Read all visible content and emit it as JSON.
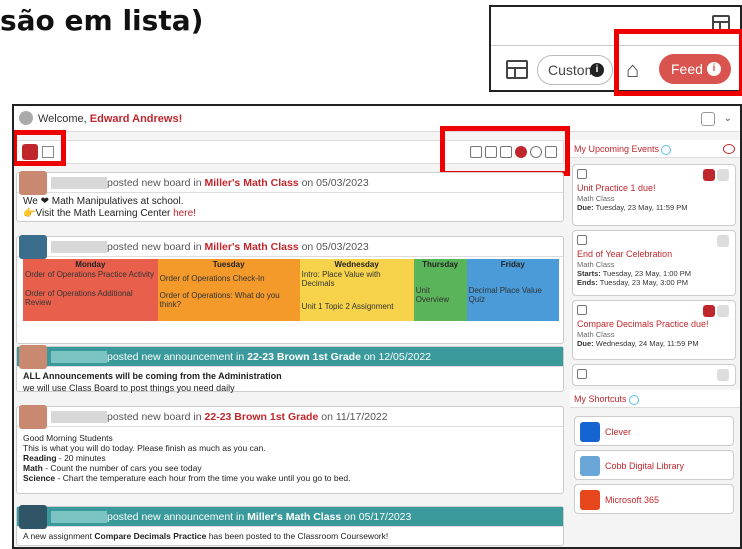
{
  "page_title": "são em lista)",
  "zoom_panel": {
    "custom_label": "Custom",
    "feed_label": "Feed",
    "info_glyph": "i"
  },
  "header": {
    "welcome_prefix": "Welcome,",
    "user_name": "Edward Andrews!"
  },
  "posts": [
    {
      "action": "posted new board",
      "in_word": "in",
      "class_name": "Miller's Math Class",
      "on_word": "on",
      "date": "05/03/2023",
      "line1": "We ❤ Math Manipulatives at school.",
      "line2_prefix": "👉Visit the Math Learning Center ",
      "line2_link": "here!"
    },
    {
      "action": "posted new board",
      "in_word": "in",
      "class_name": "Miller's Math Class",
      "on_word": "on",
      "date": "05/03/2023",
      "days": [
        "Monday",
        "Tuesday",
        "Wednesday",
        "Thursday",
        "Friday"
      ],
      "cells": [
        [
          "Order of Operations Practice Activity",
          "Order of Operations Additional Review"
        ],
        [
          "Order of Operations Check-In",
          "Order of Operations: What do you think?"
        ],
        [
          "Intro: Place Value with Decimals",
          "Unit 1 Topic 2 Assignment"
        ],
        [
          "Unit Overview"
        ],
        [
          "Decimal Place Value Quiz"
        ]
      ]
    },
    {
      "action": "posted new announcement",
      "in_word": "in",
      "class_name": "22-23 Brown 1st Grade",
      "on_word": "on",
      "date": "12/05/2022",
      "line1": "ALL Announcements will be coming from the Administration",
      "line2": "we will use Class Board to post things you need daily"
    },
    {
      "action": "posted new board",
      "in_word": "in",
      "class_name": "22-23 Brown 1st Grade",
      "on_word": "on",
      "date": "11/17/2022",
      "lines": [
        "Good Morning Students",
        "This is what you will do today.  Please finish as much as you can."
      ],
      "items": [
        {
          "label": "Reading",
          "text": " - 20 minutes"
        },
        {
          "label": "Math",
          "text": " - Count the number of cars you see today"
        },
        {
          "label": "Science",
          "text": " - Chart the temperature each hour from the time you wake until you go to bed."
        }
      ]
    },
    {
      "action": "posted new announcement",
      "in_word": "in",
      "class_name": "Miller's Math Class",
      "on_word": "on",
      "date": "05/17/2023",
      "text_prefix": "A new assignment ",
      "text_bold": "Compare Decimals Practice",
      "text_suffix": " has been posted to the Classroom Coursework!"
    }
  ],
  "events_panel": {
    "title": "My Upcoming Events",
    "events": [
      {
        "title": "Unit Practice 1 due!",
        "class": "Math Class",
        "line1_label": "Due:",
        "line1": "Tuesday, 23 May, 11:59 PM"
      },
      {
        "title": "End of Year Celebration",
        "class": "Math Class",
        "line1_label": "Starts:",
        "line1": "Tuesday, 23 May, 1:00 PM",
        "line2_label": "Ends:",
        "line2": "Tuesday, 23 May, 3:00 PM"
      },
      {
        "title": "Compare Decimals Practice due!",
        "class": "Math Class",
        "line1_label": "Due:",
        "line1": "Wednesday, 24 May, 11:59 PM"
      }
    ]
  },
  "shortcuts_panel": {
    "title": "My Shortcuts",
    "items": [
      {
        "label": "Clever",
        "color": "#1464d2"
      },
      {
        "label": "Cobb Digital Library",
        "color": "#6aa7d8"
      },
      {
        "label": "Microsoft 365",
        "color": "#e8461d"
      }
    ]
  },
  "colors": {
    "accent": "#c0272d",
    "teal": "#3a9a9b",
    "highlight": "#ee0000"
  }
}
